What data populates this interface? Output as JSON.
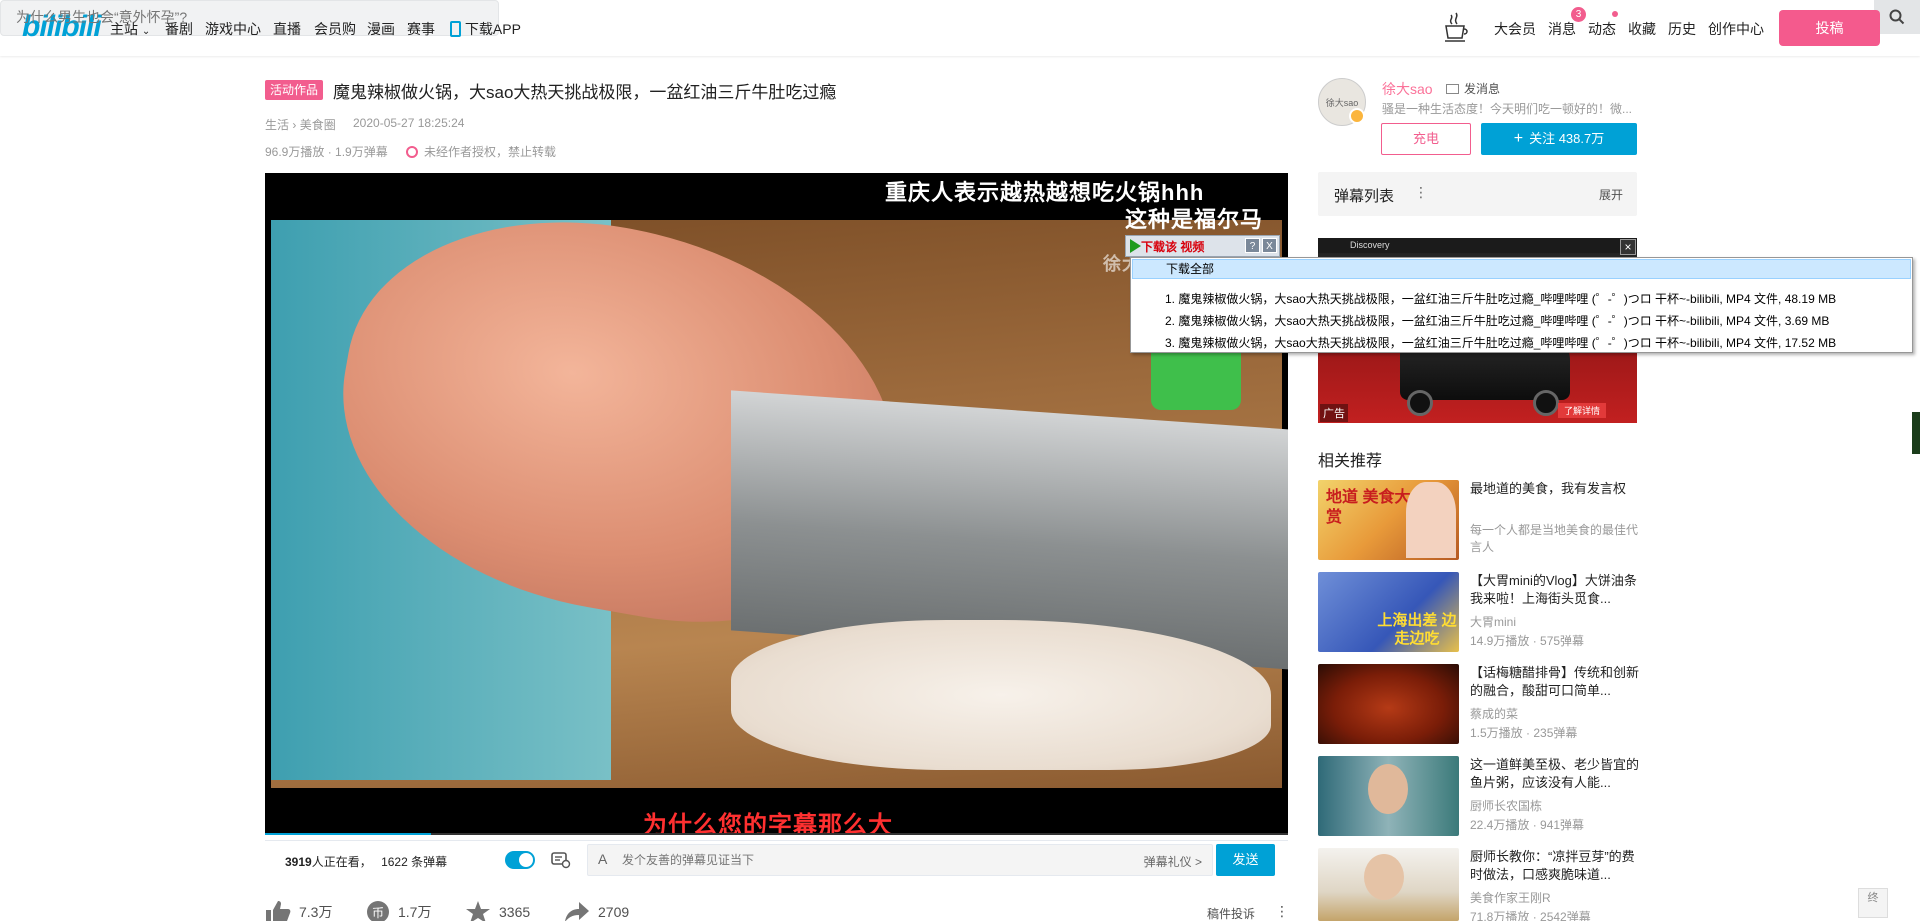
{
  "header": {
    "logo": "bilibili",
    "nav": [
      "主站",
      "番剧",
      "游戏中心",
      "直播",
      "会员购",
      "漫画",
      "赛事"
    ],
    "download_app": "下载APP",
    "search_placeholder": "为什么男生也会“意外怀孕”?",
    "right_nav": [
      "大会员",
      "消息",
      "动态",
      "收藏",
      "历史",
      "创作中心"
    ],
    "message_badge": "3",
    "upload_label": "投稿"
  },
  "video": {
    "activity_tag": "活动作品",
    "title": "魔鬼辣椒做火锅，大sao大热天挑战极限，一盆红油三斤牛肚吃过瘾",
    "category": "生活",
    "subcategory": "美食圈",
    "date": "2020-05-27 18:25:24",
    "stats": "96.9万播放 · 1.9万弹幕",
    "copyright_notice": "未经作者授权，禁止转载"
  },
  "player": {
    "subtitle_line1": "重庆人表示越热越想吃火锅hhh",
    "subtitle_line2": "这种是福尔马",
    "watermark": "徐大",
    "danmaku_red": "为什么您的字幕那么大",
    "viewers_count": "3919",
    "viewers_text": "人正在看，",
    "danmaku_count": "1622 条弹幕",
    "toggle_label": "弹",
    "danmaku_placeholder": "发个友善的弹幕见证当下",
    "etiquette": "弹幕礼仪 >",
    "send_label": "发送"
  },
  "actions": {
    "like": "7.3万",
    "coin": "1.7万",
    "favorite": "3365",
    "share": "2709",
    "report": "稿件投诉"
  },
  "uploader": {
    "name": "徐大sao",
    "message_label": "发消息",
    "desc": "骚是一种生活态度！今天明们吃一顿好的！微...",
    "charge_label": "充电",
    "follow_label": "关注 438.7万",
    "avatar_text": "徐大sao"
  },
  "danmaku_list": {
    "title": "弹幕列表",
    "expand": "展开"
  },
  "ad": {
    "strip_text": "Discovery",
    "label": "广告",
    "button": "了解详情"
  },
  "recommend": {
    "title": "相关推荐",
    "items": [
      {
        "title": "最地道的美食，我有发言权",
        "line2": "每一个人都是当地美食的最佳代言人",
        "line3": "",
        "thumb_text": "地道 美食大赏"
      },
      {
        "title": "【大胃mini的Vlog】大饼油条我来啦！上海街头觅食...",
        "line2": "大胃mini",
        "line3": "14.9万播放 · 575弹幕",
        "thumb_text": "上海出差 边走边吃"
      },
      {
        "title": "【话梅糖醋排骨】传统和创新的融合，酸甜可口简单...",
        "line2": "蔡成的菜",
        "line3": "1.5万播放 · 235弹幕",
        "thumb_text": ""
      },
      {
        "title": "这一道鲜美至极、老少皆宜的鱼片粥，应该没有人能...",
        "line2": "厨师长农国栋",
        "line3": "22.4万播放 · 941弹幕",
        "thumb_text": ""
      },
      {
        "title": "厨师长教你：“凉拌豆芽”的费时做法，口感爽脆味道...",
        "line2": "美食作家王刚R",
        "line3": "71.8万播放 · 2542弹幕",
        "thumb_text": ""
      }
    ]
  },
  "download_overlay": {
    "bar_label": "下载该 视频",
    "help": "?",
    "close": "X",
    "all": "下载全部",
    "items": [
      "1.  魔鬼辣椒做火锅，大sao大热天挑战极限，一盆红油三斤牛肚吃过瘾_哔哩哔哩 (゜-゜)つロ 干杯~-bilibili,  MP4 文件, 48.19 MB",
      "2.  魔鬼辣椒做火锅，大sao大热天挑战极限，一盆红油三斤牛肚吃过瘾_哔哩哔哩 (゜-゜)つロ 干杯~-bilibili,  MP4 文件, 3.69 MB",
      "3.  魔鬼辣椒做火锅，大sao大热天挑战极限，一盆红油三斤牛肚吃过瘾_哔哩哔哩 (゜-゜)つロ 干杯~-bilibili,  MP4 文件, 17.52 MB"
    ]
  },
  "misc": {
    "back_top": "终"
  },
  "colors": {
    "brand_blue": "#00a1d6",
    "brand_pink": "#f25d8e"
  }
}
